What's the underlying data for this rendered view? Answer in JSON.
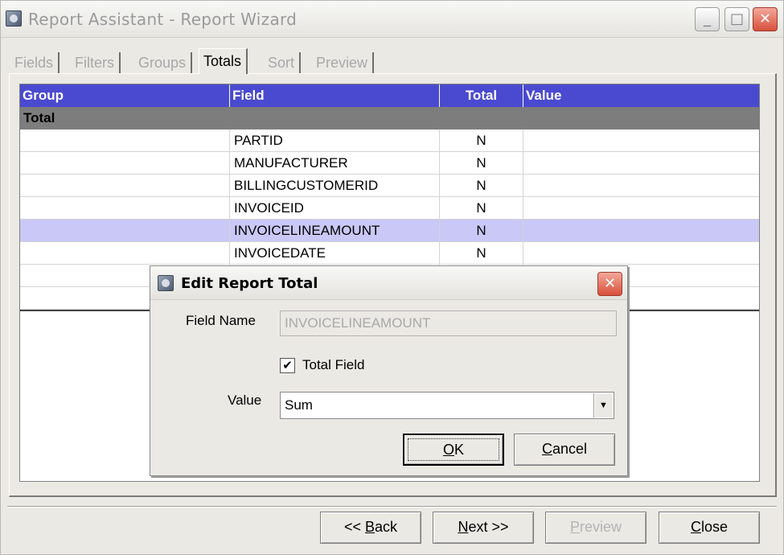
{
  "window": {
    "title": "Report Assistant - Report Wizard",
    "minimize_glyph": "_",
    "maximize_glyph": "□",
    "close_glyph": "✕"
  },
  "tabs": [
    {
      "label": "Fields",
      "active": false
    },
    {
      "label": "Filters",
      "active": false
    },
    {
      "label": "Groups",
      "active": false
    },
    {
      "label": "Totals",
      "active": true
    },
    {
      "label": "Sort",
      "active": false
    },
    {
      "label": "Preview",
      "active": false
    }
  ],
  "grid": {
    "columns": {
      "group": "Group",
      "field": "Field",
      "total": "Total",
      "value": "Value"
    },
    "group_row": "Total",
    "rows": [
      {
        "group": "",
        "field": "PARTID",
        "total": "N",
        "value": ""
      },
      {
        "group": "",
        "field": "MANUFACTURER",
        "total": "N",
        "value": ""
      },
      {
        "group": "",
        "field": "BILLINGCUSTOMERID",
        "total": "N",
        "value": ""
      },
      {
        "group": "",
        "field": "INVOICEID",
        "total": "N",
        "value": ""
      },
      {
        "group": "",
        "field": "INVOICELINEAMOUNT",
        "total": "N",
        "value": ""
      },
      {
        "group": "",
        "field": "INVOICEDATE",
        "total": "N",
        "value": ""
      }
    ],
    "selected_row": 4,
    "colors": {
      "header": "#4a4ad0",
      "group_row": "#7d7d7d",
      "selected": "#c9c8f6"
    }
  },
  "dialog": {
    "title": "Edit Report Total",
    "close_glyph": "✕",
    "field_name_label": "Field Name",
    "field_name_value": "INVOICELINEAMOUNT",
    "total_field_label": "Total Field",
    "total_field_checked": true,
    "check_glyph": "✔",
    "value_label": "Value",
    "value_selected": "Sum",
    "dropdown_glyph": "▼",
    "ok_label_underlined": "O",
    "ok_label_rest": "K",
    "cancel_label_underlined": "C",
    "cancel_label_rest": "ancel"
  },
  "buttons": {
    "back_prefix": "<< ",
    "back_underlined": "B",
    "back_rest": "ack",
    "next_underlined": "N",
    "next_rest": "ext >>",
    "preview_underlined": "P",
    "preview_rest": "review",
    "close_underlined": "C",
    "close_rest": "lose"
  }
}
